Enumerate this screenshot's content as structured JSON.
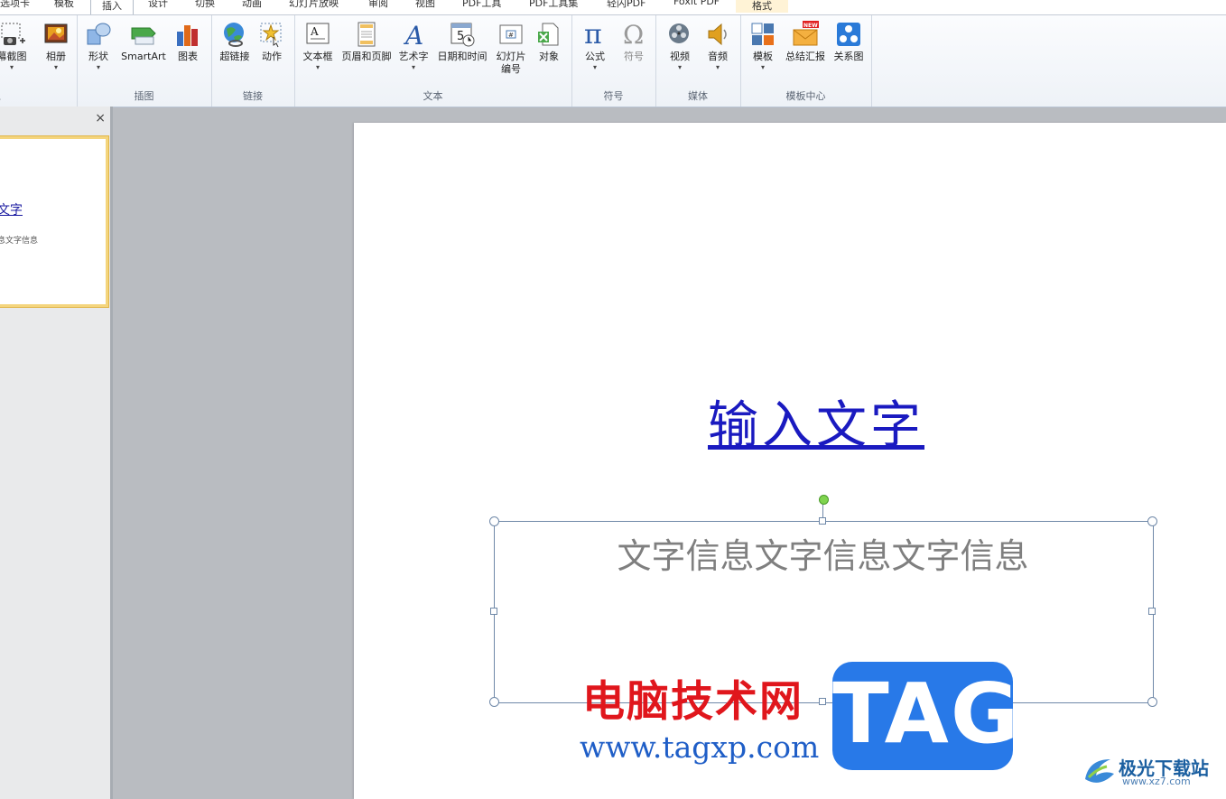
{
  "tabs": [
    "选项卡",
    "模板",
    "插入",
    "设计",
    "切换",
    "动画",
    "幻灯片放映",
    "审阅",
    "视图",
    "PDF工具",
    "PDF工具集",
    "轻闪PDF",
    "Foxit PDF",
    "格式"
  ],
  "ribbon": {
    "groups": {
      "images": "像",
      "illustrations": "插图",
      "links": "链接",
      "text": "文本",
      "symbols": "符号",
      "media": "媒体",
      "template_center": "模板中心"
    },
    "buttons": {
      "screenshot": "幕截图",
      "album": "相册",
      "shapes": "形状",
      "smartart": "SmartArt",
      "chart": "图表",
      "hyperlink": "超链接",
      "action": "动作",
      "textbox": "文本框",
      "header_footer": "页眉和页脚",
      "wordart": "艺术字",
      "datetime": "日期和时间",
      "slide_number_1": "幻灯片",
      "slide_number_2": "编号",
      "object": "对象",
      "equation": "公式",
      "symbol": "符号",
      "video": "视频",
      "audio": "音频",
      "template": "模板",
      "summary_report": "总结汇报",
      "relation_chart": "关系图",
      "new_badge": "NEW"
    }
  },
  "panel": {
    "close": "×",
    "thumb_title": "文字",
    "thumb_subtitle": "息文字信息"
  },
  "slide": {
    "title": "输入文字",
    "subtitle": "文字信息文字信息文字信息"
  },
  "watermark": {
    "site_cn": "电脑技术网",
    "site_url": "www.tagxp.com",
    "tag": "TAG",
    "logo_text": "极光下载站",
    "logo_url": "www.xz7.com"
  },
  "colors": {
    "title_link": "#1a1ac0",
    "subtitle_text": "#7f7f7f",
    "watermark_red": "#e0161c",
    "watermark_blue": "#2879e8"
  }
}
